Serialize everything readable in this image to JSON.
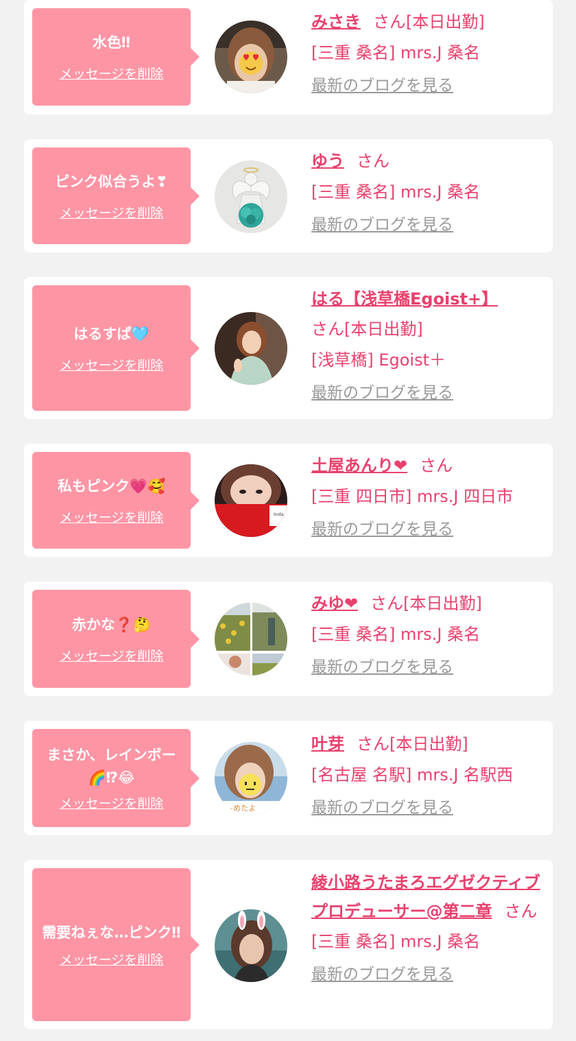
{
  "cards": [
    {
      "message": "水色‼",
      "delete_label": "メッセージを削除",
      "avatar": "avatar-photo-heart-eyes",
      "name": "みさき",
      "san": "さん",
      "status": "[本日出勤]",
      "shop": "[三重 桑名] mrs.J 桑名",
      "blog_label": "最新のブログを見る"
    },
    {
      "message": "ピンク似合うよ❣",
      "delete_label": "メッセージを削除",
      "avatar": "avatar-angel-figurine",
      "name": "ゆう",
      "san": "さん",
      "status": "",
      "shop": "[三重 桑名] mrs.J 桑名",
      "blog_label": "最新のブログを見る"
    },
    {
      "message": "はるすぱ🩵",
      "delete_label": "メッセージを削除",
      "avatar": "avatar-photo-woman",
      "name": "はる【浅草橋Egoist+】",
      "san": "さん",
      "status": "[本日出勤]",
      "shop": "[浅草橋] Egoist＋",
      "blog_label": "最新のブログを見る"
    },
    {
      "message": "私もピンク💗🥰",
      "delete_label": "メッセージを削除",
      "avatar": "avatar-photo-red-card",
      "name": "土屋あんり❤",
      "san": "さん",
      "status": "",
      "shop": "[三重 四日市] mrs.J 四日市",
      "blog_label": "最新のブログを見る"
    },
    {
      "message": "赤かな❓🤔",
      "delete_label": "メッセージを削除",
      "avatar": "avatar-collage-sunflower",
      "name": "みゆ❤",
      "san": "さん",
      "status": "[本日出勤]",
      "shop": "[三重 桑名] mrs.J 桑名",
      "blog_label": "最新のブログを見る"
    },
    {
      "message": "まさか、レインボー🌈⁉😂",
      "delete_label": "メッセージを削除",
      "avatar": "avatar-photo-smiley-sticker",
      "name": "叶芽",
      "san": "さん",
      "status": "[本日出勤]",
      "shop": "[名古屋 名駅] mrs.J 名駅西",
      "blog_label": "最新のブログを見る"
    },
    {
      "message": "需要ねぇな…ピンク‼",
      "delete_label": "メッセージを削除",
      "avatar": "avatar-photo-bunny-ears",
      "name": "綾小路うたまろエグゼクティブプロデューサー@第二章",
      "san": "さん",
      "status": "",
      "shop": "[三重 桑名] mrs.J 桑名",
      "blog_label": "最新のブログを見る"
    }
  ],
  "colors": {
    "background": "#f2f2f2",
    "bubble": "#fe95a5",
    "accent": "#e8416d",
    "link_gray": "#999999"
  }
}
